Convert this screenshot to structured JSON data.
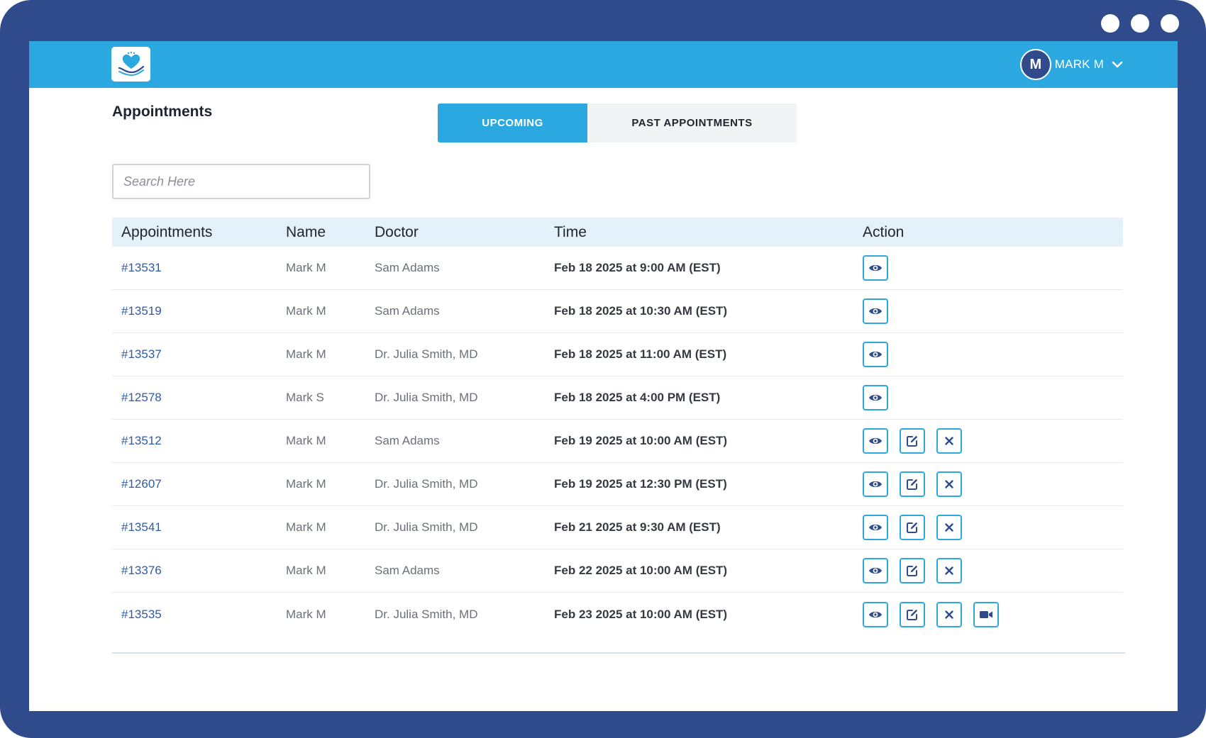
{
  "user": {
    "avatar_letter": "M",
    "name": "MARK M"
  },
  "page": {
    "title": "Appointments"
  },
  "tabs": [
    {
      "label": "UPCOMING",
      "active": true
    },
    {
      "label": "PAST APPOINTMENTS",
      "active": false
    }
  ],
  "search": {
    "placeholder": "Search Here",
    "value": ""
  },
  "table": {
    "headers": [
      "Appointments",
      "Name",
      "Doctor",
      "Time",
      "Action"
    ],
    "rows": [
      {
        "id": "#13531",
        "name": "Mark M",
        "doctor": "Sam Adams",
        "time": "Feb 18 2025 at 9:00 AM (EST)",
        "actions": [
          "view"
        ]
      },
      {
        "id": "#13519",
        "name": "Mark M",
        "doctor": "Sam Adams",
        "time": "Feb 18 2025 at 10:30 AM (EST)",
        "actions": [
          "view"
        ]
      },
      {
        "id": "#13537",
        "name": "Mark M",
        "doctor": "Dr. Julia Smith, MD",
        "time": "Feb 18 2025 at 11:00 AM (EST)",
        "actions": [
          "view"
        ]
      },
      {
        "id": "#12578",
        "name": "Mark S",
        "doctor": "Dr. Julia Smith, MD",
        "time": "Feb 18 2025 at 4:00 PM (EST)",
        "actions": [
          "view"
        ]
      },
      {
        "id": "#13512",
        "name": "Mark M",
        "doctor": "Sam Adams",
        "time": "Feb 19 2025 at 10:00 AM (EST)",
        "actions": [
          "view",
          "edit",
          "cancel"
        ]
      },
      {
        "id": "#12607",
        "name": "Mark M",
        "doctor": "Dr. Julia Smith, MD",
        "time": "Feb 19 2025 at 12:30 PM (EST)",
        "actions": [
          "view",
          "edit",
          "cancel"
        ]
      },
      {
        "id": "#13541",
        "name": "Mark M",
        "doctor": "Dr. Julia Smith, MD",
        "time": "Feb 21 2025 at 9:30 AM (EST)",
        "actions": [
          "view",
          "edit",
          "cancel"
        ]
      },
      {
        "id": "#13376",
        "name": "Mark M",
        "doctor": "Sam Adams",
        "time": "Feb 22 2025 at 10:00 AM (EST)",
        "actions": [
          "view",
          "edit",
          "cancel"
        ]
      },
      {
        "id": "#13535",
        "name": "Mark M",
        "doctor": "Dr. Julia Smith, MD",
        "time": "Feb 23 2025 at 10:00 AM (EST)",
        "actions": [
          "view",
          "edit",
          "cancel",
          "video"
        ]
      }
    ]
  },
  "action_icons": {
    "view": "eye-icon",
    "edit": "edit-icon",
    "cancel": "close-icon",
    "video": "video-camera-icon"
  },
  "colors": {
    "frame": "#2f4b8c",
    "topbar": "#2aa8df",
    "header_row": "#e3f1fb",
    "link": "#2f5aa8",
    "icon": "#2f4b8c",
    "button_border": "#2aa8df"
  }
}
